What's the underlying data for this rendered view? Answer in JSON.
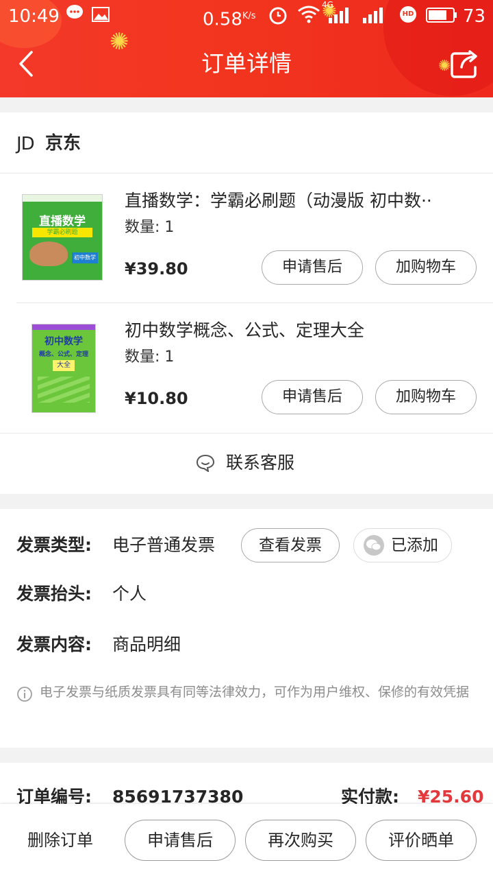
{
  "status_bar": {
    "time": "10:49",
    "speed": "0.58",
    "speed_unit": "K/s",
    "battery": "73",
    "net_badge": "4G",
    "hd_badge": "HD",
    "icons": [
      "chat-icon",
      "image-icon",
      "alarm-icon",
      "wifi-icon",
      "signal-icon",
      "hd-icon",
      "battery-icon"
    ]
  },
  "header": {
    "title": "订单详情",
    "back_icon": "chevron-left-icon",
    "share_icon": "share-icon"
  },
  "shop": {
    "logo_text": "JD",
    "name": "京东"
  },
  "products": [
    {
      "title": "直播数学：学霸必刷题（动漫版 初中数··",
      "quantity": "数量: 1",
      "price": "¥39.80",
      "after_sale_label": "申请售后",
      "add_cart_label": "加购物车",
      "cover_text": "直播数学",
      "cover_sub": "学霸必刷题",
      "cover_badge": "初中数学"
    },
    {
      "title": "初中数学概念、公式、定理大全",
      "quantity": "数量: 1",
      "price": "¥10.80",
      "after_sale_label": "申请售后",
      "add_cart_label": "加购物车",
      "cover_text": "初中数学",
      "cover_sub": "概念、公式、定理",
      "cover_badge": "大全"
    }
  ],
  "customer_service": {
    "label": "联系客服",
    "icon": "smile-chat-icon"
  },
  "invoice": {
    "type_label": "发票类型:",
    "type_value": "电子普通发票",
    "view_button": "查看发票",
    "added_button": "已添加",
    "title_label": "发票抬头:",
    "title_value": "个人",
    "content_label": "发票内容:",
    "content_value": "商品明细",
    "note": "电子发票与纸质发票具有同等法律效力，可作为用户维权、保修的有效凭据"
  },
  "order": {
    "number_label": "订单编号:",
    "number_value": "85691737380",
    "paid_label": "实付款:",
    "paid_value": "¥25.60"
  },
  "bottom_bar": {
    "delete_label": "删除订单",
    "after_sale_label": "申请售后",
    "rebuy_label": "再次购买",
    "review_label": "评价晒单"
  },
  "colors": {
    "header_red": "#f2361f",
    "price_red": "#e4393c",
    "book1_green": "#3fae3a",
    "book2_green": "#6cc63b"
  }
}
